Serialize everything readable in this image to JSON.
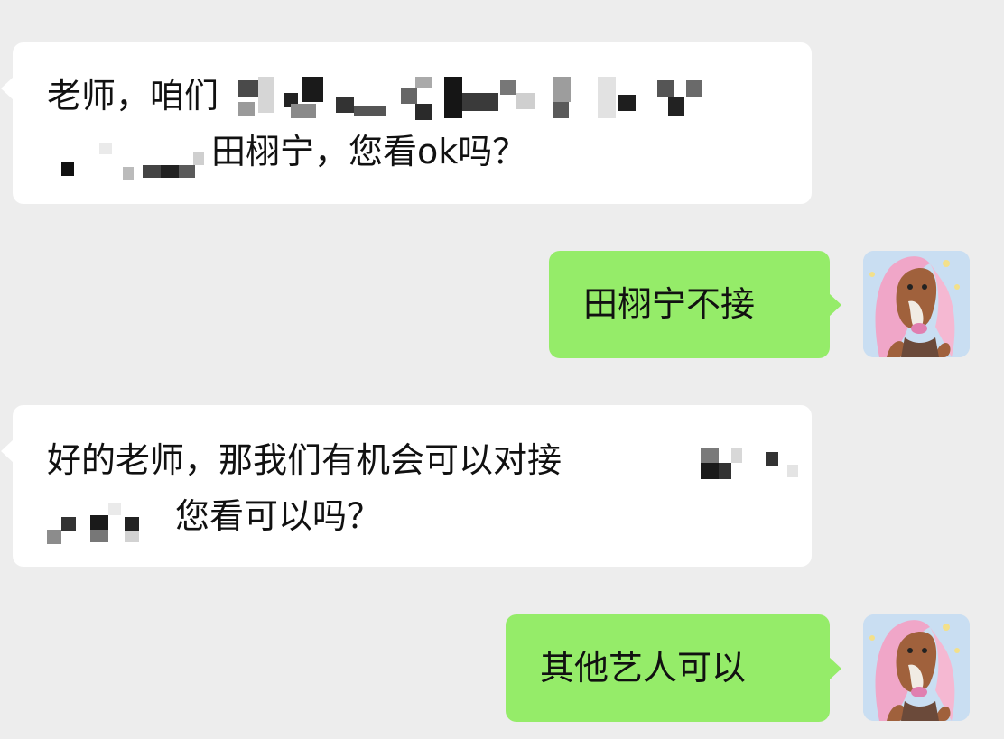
{
  "messages": [
    {
      "direction": "incoming",
      "line1_prefix": "老师，咱们",
      "line2_suffix": "田栩宁，您看ok吗？"
    },
    {
      "direction": "outgoing",
      "text": "田栩宁不接"
    },
    {
      "direction": "incoming",
      "line1": "好的老师，那我们有机会可以对接",
      "line2": "您看可以吗？"
    },
    {
      "direction": "outgoing",
      "text": "其他艺人可以"
    }
  ],
  "colors": {
    "background": "#ededed",
    "incoming_bubble": "#ffffff",
    "outgoing_bubble": "#95ec69"
  },
  "avatar_icon": "horse-character-avatar-icon"
}
